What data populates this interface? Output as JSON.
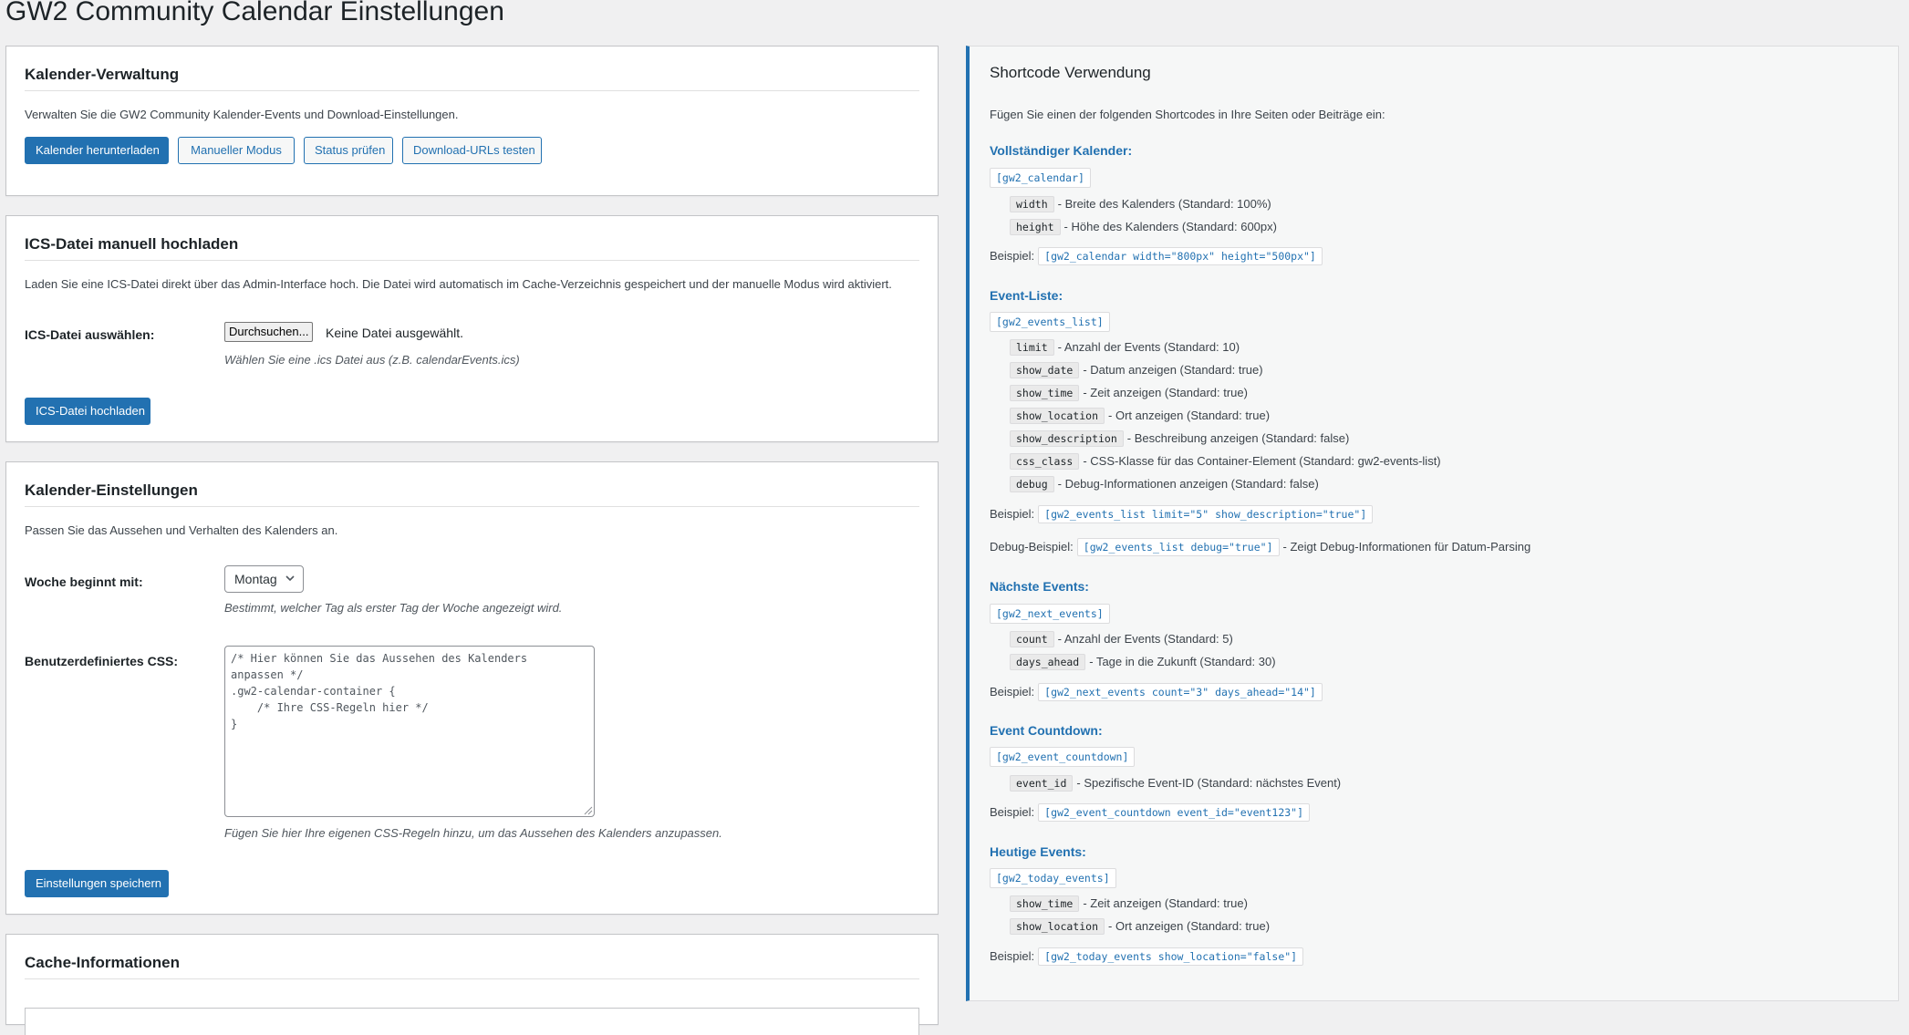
{
  "page": {
    "title": "GW2 Community Calendar Einstellungen"
  },
  "management": {
    "title": "Kalender-Verwaltung",
    "description": "Verwalten Sie die GW2 Community Kalender-Events und Download-Einstellungen.",
    "buttons": [
      "Kalender herunterladen",
      "Manueller Modus",
      "Status prüfen",
      "Download-URLs testen"
    ]
  },
  "upload": {
    "title": "ICS-Datei manuell hochladen",
    "description": "Laden Sie eine ICS-Datei direkt über das Admin-Interface hoch. Die Datei wird automatisch im Cache-Verzeichnis gespeichert und der manuelle Modus wird aktiviert.",
    "file_label": "ICS-Datei auswählen:",
    "browse_label": "Durchsuchen...",
    "no_file": "Keine Datei ausgewählt.",
    "hint": "Wählen Sie eine .ics Datei aus (z.B. calendarEvents.ics)",
    "submit": "ICS-Datei hochladen"
  },
  "settings": {
    "title": "Kalender-Einstellungen",
    "description": "Passen Sie das Aussehen und Verhalten des Kalenders an.",
    "week_label": "Woche beginnt mit:",
    "week_value": "Montag",
    "week_hint": "Bestimmt, welcher Tag als erster Tag der Woche angezeigt wird.",
    "css_label": "Benutzerdefiniertes CSS:",
    "css_value": "/* Hier können Sie das Aussehen des Kalenders\nanpassen */\n.gw2-calendar-container {\n    /* Ihre CSS-Regeln hier */\n}",
    "css_hint": "Fügen Sie hier Ihre eigenen CSS-Regeln hinzu, um das Aussehen des Kalenders anzupassen.",
    "save": "Einstellungen speichern"
  },
  "cache": {
    "title": "Cache-Informationen"
  },
  "shortcodes": {
    "title": "Shortcode Verwendung",
    "intro": "Fügen Sie einen der folgenden Shortcodes in Ihre Seiten oder Beiträge ein:",
    "example_label": "Beispiel:",
    "full": {
      "title": "Vollständiger Kalender:",
      "code": "[gw2_calendar]",
      "params": [
        {
          "name": "width",
          "desc": "- Breite des Kalenders (Standard: 100%)"
        },
        {
          "name": "height",
          "desc": "- Höhe des Kalenders (Standard: 600px)"
        }
      ],
      "example": "[gw2_calendar width=\"800px\" height=\"500px\"]"
    },
    "list": {
      "title": "Event-Liste:",
      "code": "[gw2_events_list]",
      "params": [
        {
          "name": "limit",
          "desc": "- Anzahl der Events (Standard: 10)"
        },
        {
          "name": "show_date",
          "desc": "- Datum anzeigen (Standard: true)"
        },
        {
          "name": "show_time",
          "desc": "- Zeit anzeigen (Standard: true)"
        },
        {
          "name": "show_location",
          "desc": "- Ort anzeigen (Standard: true)"
        },
        {
          "name": "show_description",
          "desc": "- Beschreibung anzeigen (Standard: false)"
        },
        {
          "name": "css_class",
          "desc": "- CSS-Klasse für das Container-Element (Standard: gw2-events-list)"
        },
        {
          "name": "debug",
          "desc": "- Debug-Informationen anzeigen (Standard: false)"
        }
      ],
      "example": "[gw2_events_list limit=\"5\" show_description=\"true\"]",
      "debug_label": "Debug-Beispiel:",
      "debug_example": "[gw2_events_list debug=\"true\"]",
      "debug_desc": "- Zeigt Debug-Informationen für Datum-Parsing"
    },
    "next": {
      "title": "Nächste Events:",
      "code": "[gw2_next_events]",
      "params": [
        {
          "name": "count",
          "desc": "- Anzahl der Events (Standard: 5)"
        },
        {
          "name": "days_ahead",
          "desc": "- Tage in die Zukunft (Standard: 30)"
        }
      ],
      "example": "[gw2_next_events count=\"3\" days_ahead=\"14\"]"
    },
    "countdown": {
      "title": "Event Countdown:",
      "code": "[gw2_event_countdown]",
      "params": [
        {
          "name": "event_id",
          "desc": "- Spezifische Event-ID (Standard: nächstes Event)"
        }
      ],
      "example": "[gw2_event_countdown event_id=\"event123\"]"
    },
    "today": {
      "title": "Heutige Events:",
      "code": "[gw2_today_events]",
      "params": [
        {
          "name": "show_time",
          "desc": "- Zeit anzeigen (Standard: true)"
        },
        {
          "name": "show_location",
          "desc": "- Ort anzeigen (Standard: true)"
        }
      ],
      "example": "[gw2_today_events show_location=\"false\"]"
    }
  }
}
